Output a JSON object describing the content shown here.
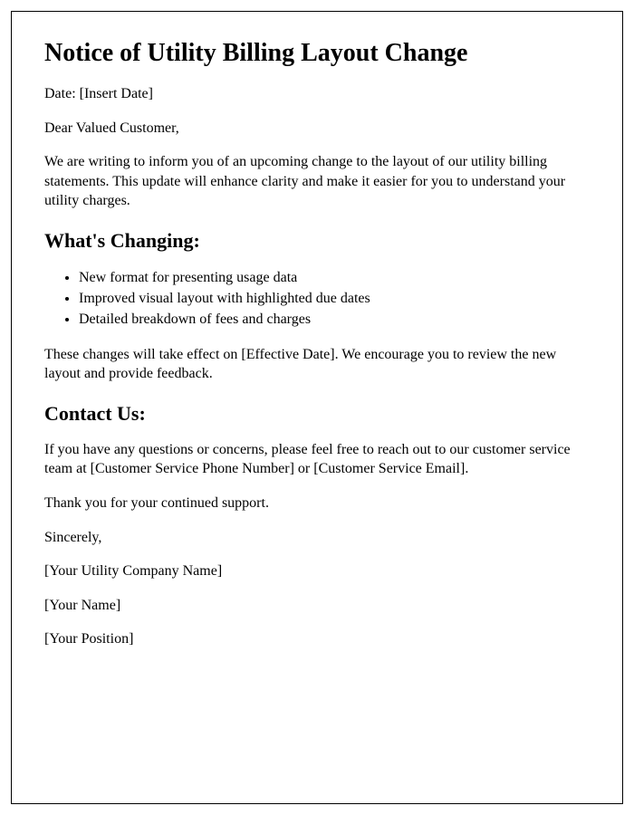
{
  "title": "Notice of Utility Billing Layout Change",
  "date_line": "Date: [Insert Date]",
  "salutation": "Dear Valued Customer,",
  "intro": "We are writing to inform you of an upcoming change to the layout of our utility billing statements. This update will enhance clarity and make it easier for you to understand your utility charges.",
  "section_changes": {
    "heading": "What's Changing:",
    "items": [
      "New format for presenting usage data",
      "Improved visual layout with highlighted due dates",
      "Detailed breakdown of fees and charges"
    ],
    "effective": "These changes will take effect on [Effective Date]. We encourage you to review the new layout and provide feedback."
  },
  "section_contact": {
    "heading": "Contact Us:",
    "body": "If you have any questions or concerns, please feel free to reach out to our customer service team at [Customer Service Phone Number] or [Customer Service Email]."
  },
  "thanks": "Thank you for your continued support.",
  "closing": "Sincerely,",
  "company": "[Your Utility Company Name]",
  "sender_name": "[Your Name]",
  "sender_position": "[Your Position]"
}
